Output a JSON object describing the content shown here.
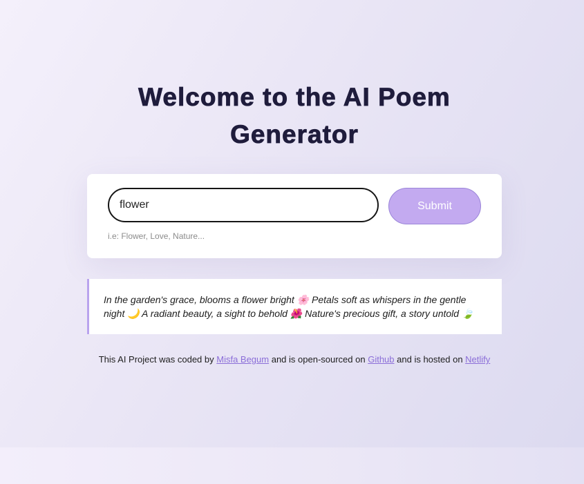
{
  "header": {
    "title": "Welcome to the AI Poem Generator"
  },
  "form": {
    "input_value": "flower",
    "submit_label": "Submit",
    "hint": "i.e: Flower, Love, Nature..."
  },
  "poem": {
    "text": "In the garden's grace, blooms a flower bright 🌸 Petals soft as whispers in the gentle night 🌙 A radiant beauty, a sight to behold 🌺 Nature's precious gift, a story untold 🍃"
  },
  "footer": {
    "text_1": "This AI Project was coded by ",
    "author_link": "Misfa Begum",
    "text_2": " and is open-sourced on ",
    "github_link": "Github",
    "text_3": " and is hosted on ",
    "netlify_link": "Netlify"
  },
  "colors": {
    "accent": "#c3aaf0",
    "title": "#1f1c3c",
    "link": "#8b6ed8"
  }
}
